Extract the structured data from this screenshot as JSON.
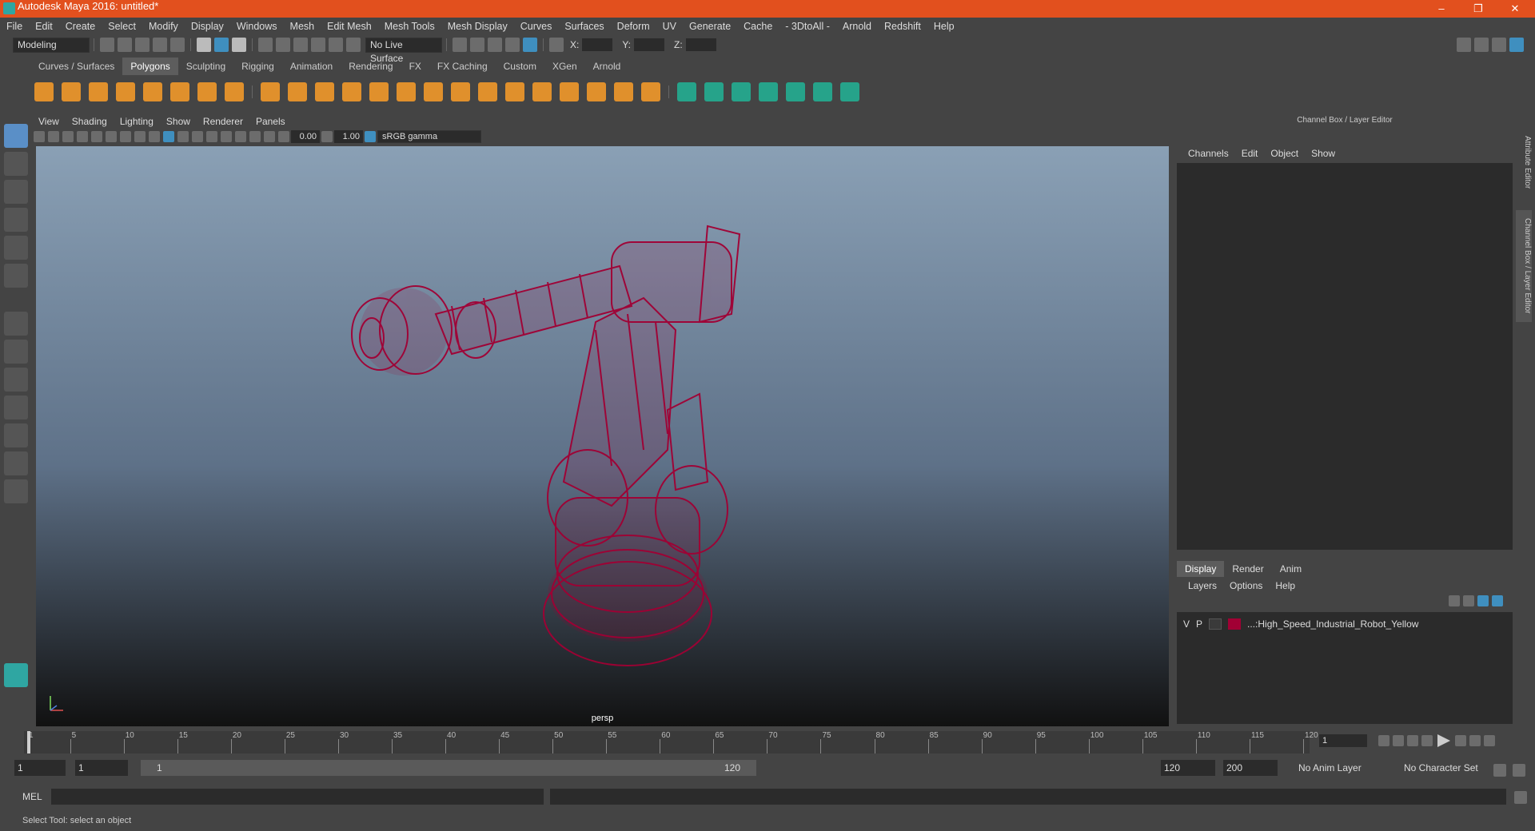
{
  "window": {
    "title": "Autodesk Maya 2016: untitled*",
    "controls": [
      "–",
      "❐",
      "✕"
    ],
    "accent": "#e2501e"
  },
  "menubar": [
    "File",
    "Edit",
    "Create",
    "Select",
    "Modify",
    "Display",
    "Windows",
    "Mesh",
    "Edit Mesh",
    "Mesh Tools",
    "Mesh Display",
    "Curves",
    "Surfaces",
    "Deform",
    "UV",
    "Generate",
    "Cache",
    "- 3DtoAll -",
    "Arnold",
    "Redshift",
    "Help"
  ],
  "toolrow": {
    "mode": "Modeling",
    "live_surface": "No Live Surface",
    "x_label": "X:",
    "y_label": "Y:",
    "z_label": "Z:"
  },
  "shelf": {
    "tabs": [
      "Curves / Surfaces",
      "Polygons",
      "Sculpting",
      "Rigging",
      "Animation",
      "Rendering",
      "FX",
      "FX Caching",
      "Custom",
      "XGen",
      "Arnold"
    ],
    "active": "Polygons"
  },
  "viewport": {
    "menu": [
      "View",
      "Shading",
      "Lighting",
      "Show",
      "Renderer",
      "Panels"
    ],
    "exposure": "0.00",
    "gamma": "1.00",
    "colorspace": "sRGB gamma",
    "camera": "persp",
    "mesh_color": "#a10034"
  },
  "channelbox": {
    "title": "Channel Box / Layer Editor",
    "menu": [
      "Channels",
      "Edit",
      "Object",
      "Show"
    ]
  },
  "layereditor": {
    "tabs": [
      "Display",
      "Render",
      "Anim"
    ],
    "active": "Display",
    "menu": [
      "Layers",
      "Options",
      "Help"
    ],
    "layers": [
      {
        "v": "V",
        "p": "P",
        "name": "...:High_Speed_Industrial_Robot_Yellow",
        "color": "#a10034"
      }
    ]
  },
  "sidetabs": [
    "Attribute Editor",
    "Channel Box / Layer Editor"
  ],
  "timeline": {
    "ticks": [
      "1",
      "5",
      "10",
      "15",
      "20",
      "25",
      "30",
      "35",
      "40",
      "45",
      "50",
      "55",
      "60",
      "65",
      "70",
      "75",
      "80",
      "85",
      "90",
      "95",
      "100",
      "105",
      "110",
      "115",
      "120"
    ],
    "current_frame": "1"
  },
  "range": {
    "start": "1",
    "playback_start": "1",
    "slider_start": "1",
    "slider_end": "120",
    "playback_end": "120",
    "end": "200",
    "anim_layer": "No Anim Layer",
    "char_set": "No Character Set"
  },
  "command": {
    "label": "MEL"
  },
  "status": {
    "text": "Select Tool: select an object"
  }
}
